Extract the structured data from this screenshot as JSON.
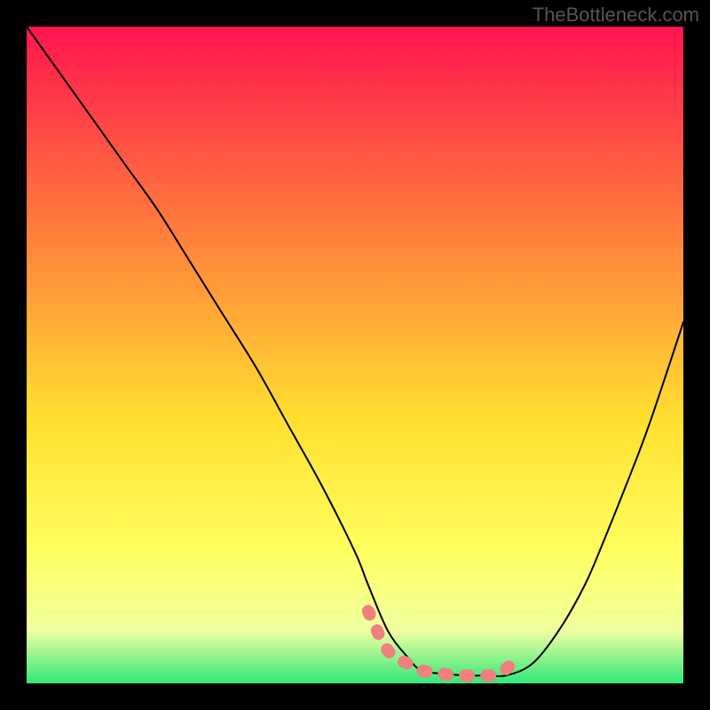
{
  "watermark": "TheBottleneck.com",
  "chart_data": {
    "type": "line",
    "title": "",
    "xlabel": "",
    "ylabel": "",
    "xlim": [
      0,
      100
    ],
    "ylim": [
      0,
      100
    ],
    "grid": false,
    "legend": false,
    "background_gradient": {
      "top": "#FF1450",
      "mid1": "#FF7A3C",
      "mid2": "#FFE030",
      "mid3": "#FFFF60",
      "mid4": "#F0FFA0",
      "bottom": "#30E878"
    },
    "series": [
      {
        "name": "bottleneck-curve",
        "color": "#000000",
        "x": [
          0,
          5,
          10,
          15,
          20,
          25,
          30,
          35,
          40,
          45,
          50,
          52,
          55,
          58,
          60,
          63,
          67,
          70,
          73,
          77,
          81,
          85,
          88,
          92,
          95,
          100
        ],
        "values": [
          100,
          93,
          86,
          79,
          72,
          64,
          56,
          48,
          39,
          30,
          20,
          15,
          8,
          4,
          2,
          1.5,
          1.2,
          1.2,
          1.2,
          3,
          8,
          15,
          22,
          32,
          40,
          55
        ]
      },
      {
        "name": "optimal-zone-marker",
        "color": "#F08080",
        "style": "thick-dotted",
        "x": [
          52,
          55,
          58,
          60,
          63,
          66,
          69,
          72,
          75
        ],
        "values": [
          11,
          5,
          3,
          2,
          1.5,
          1.2,
          1.2,
          1.5,
          4
        ]
      }
    ]
  }
}
